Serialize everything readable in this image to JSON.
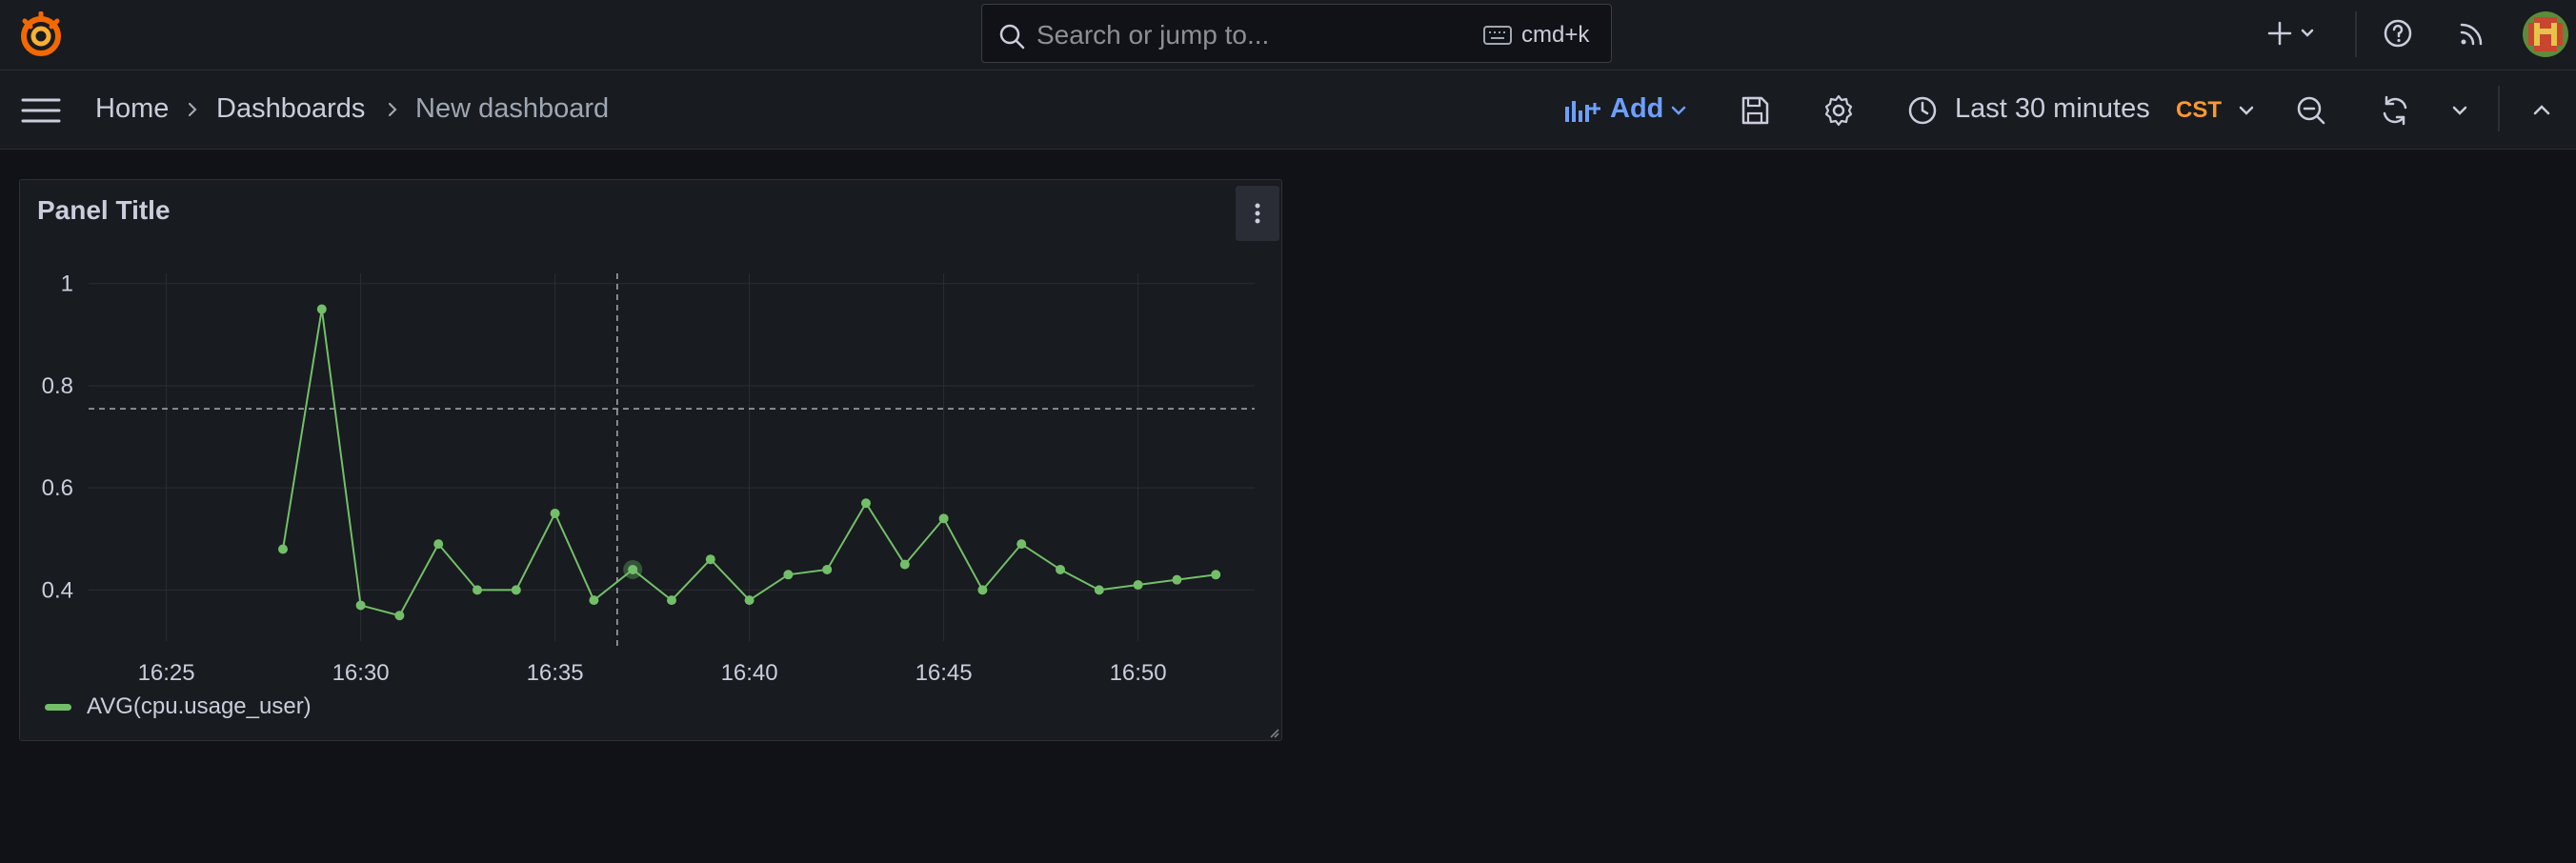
{
  "search": {
    "placeholder": "Search or jump to...",
    "shortcut": "cmd+k"
  },
  "breadcrumb": [
    "Home",
    "Dashboards",
    "New dashboard"
  ],
  "toolbar": {
    "add_label": "Add",
    "time_range": "Last 30 minutes",
    "timezone": "CST"
  },
  "colors": {
    "background": "#111217",
    "bar": "#181b1f",
    "accent": "#6e9fff",
    "series": "#73bf69",
    "timezone": "#ff9830"
  },
  "icons": {
    "logo": "grafana-logo",
    "search": "search-icon",
    "keyboard": "keyboard-icon",
    "plus": "plus-icon",
    "help": "help-icon",
    "news": "rss-icon",
    "menu": "menu-icon",
    "save": "save-icon",
    "settings": "gear-icon",
    "clock": "clock-icon",
    "zoom_out": "zoom-out-icon",
    "refresh": "refresh-icon",
    "collapse": "chevron-up-icon"
  },
  "panel": {
    "title": "Panel Title",
    "legend": "AVG(cpu.usage_user)"
  },
  "chart_data": {
    "type": "line",
    "title": "Panel Title",
    "xlabel": "",
    "ylabel": "",
    "x_ticks": [
      "16:25",
      "16:30",
      "16:35",
      "16:40",
      "16:45",
      "16:50"
    ],
    "y_ticks": [
      "0.4",
      "0.6",
      "0.8",
      "1"
    ],
    "ylim": [
      0.3,
      1.02
    ],
    "xlim": [
      "16:23",
      "16:53"
    ],
    "threshold": 0.755,
    "cursor_x": "16:36.6",
    "grid": true,
    "legend": "bottom-left",
    "series": [
      {
        "name": "AVG(cpu.usage_user)",
        "x": [
          "16:28",
          "16:29",
          "16:30",
          "16:31",
          "16:32",
          "16:33",
          "16:34",
          "16:35",
          "16:36",
          "16:37",
          "16:38",
          "16:39",
          "16:40",
          "16:41",
          "16:42",
          "16:43",
          "16:44",
          "16:45",
          "16:46",
          "16:47",
          "16:48",
          "16:49",
          "16:50",
          "16:51",
          "16:52"
        ],
        "values": [
          0.48,
          0.95,
          0.37,
          0.35,
          0.49,
          0.4,
          0.4,
          0.55,
          0.38,
          0.44,
          0.38,
          0.46,
          0.38,
          0.43,
          0.44,
          0.57,
          0.45,
          0.54,
          0.4,
          0.49,
          0.44,
          0.4,
          0.41,
          0.42,
          0.43
        ]
      }
    ]
  }
}
